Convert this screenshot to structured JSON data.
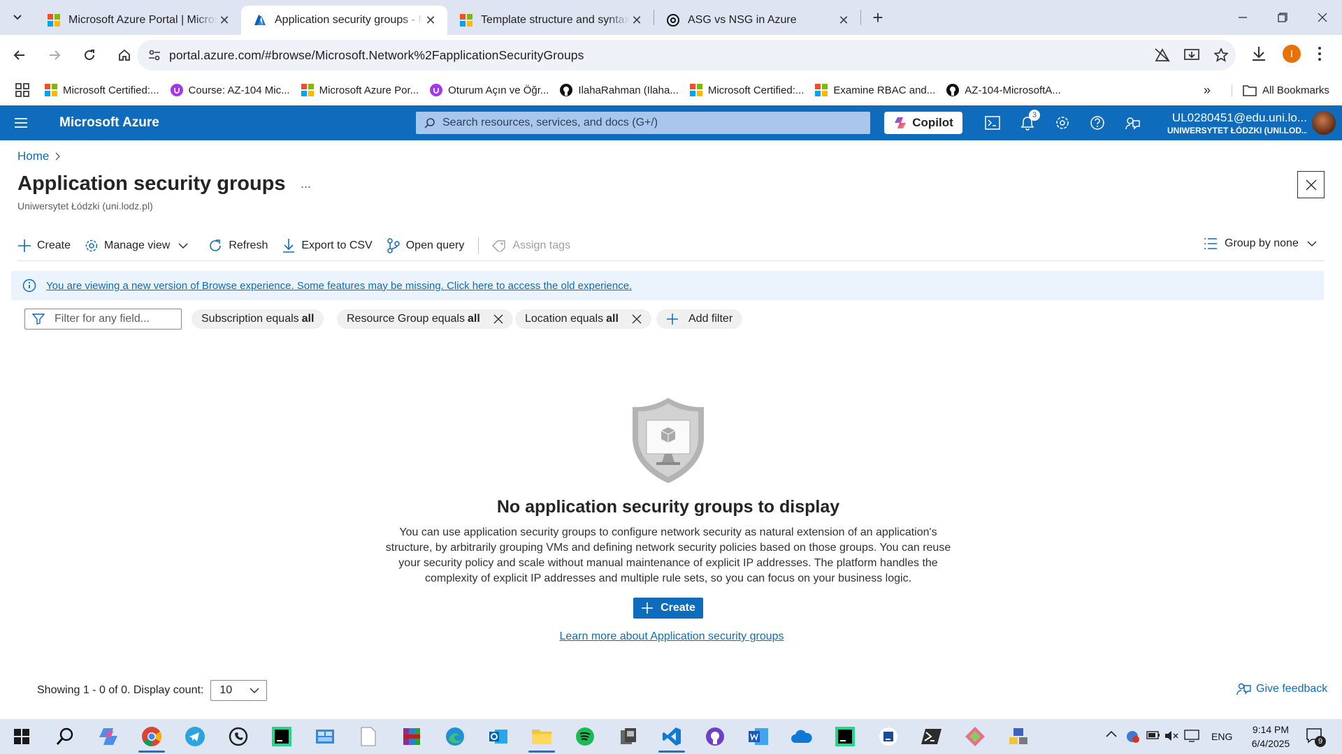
{
  "browser": {
    "tabs": [
      {
        "title": "Microsoft Azure Portal | Microsoft",
        "icon": "microsoft-logo-icon",
        "active": false
      },
      {
        "title": "Application security groups - Microsoft",
        "icon": "azure-logo-icon",
        "active": true
      },
      {
        "title": "Template structure and syntax - Azure",
        "icon": "microsoft-logo-icon",
        "active": false
      },
      {
        "title": "ASG vs NSG in Azure",
        "icon": "chatgpt-icon",
        "active": false
      }
    ],
    "url": "portal.azure.com/#browse/Microsoft.Network%2FapplicationSecurityGroups",
    "profile_initial": "I",
    "bookmarks": [
      {
        "label": "Microsoft Certified:...",
        "icon": "microsoft-logo-icon"
      },
      {
        "label": "Course: AZ-104 Mic...",
        "icon": "udemy-icon"
      },
      {
        "label": "Microsoft Azure Por...",
        "icon": "microsoft-logo-icon"
      },
      {
        "label": "Oturum Açın ve Öğr...",
        "icon": "udemy-icon"
      },
      {
        "label": "IlahaRahman (Ilaha...",
        "icon": "github-icon"
      },
      {
        "label": "Microsoft Certified:...",
        "icon": "microsoft-logo-icon"
      },
      {
        "label": "Examine RBAC and...",
        "icon": "microsoft-logo-icon"
      },
      {
        "label": "AZ-104-MicrosoftA...",
        "icon": "github-icon"
      }
    ],
    "all_bookmarks": "All Bookmarks"
  },
  "portal": {
    "brand": "Microsoft Azure",
    "search_placeholder": "Search resources, services, and docs (G+/)",
    "copilot": "Copilot",
    "notification_count": "3",
    "account_email": "UL0280451@edu.uni.lo...",
    "account_org": "UNIWERSYTET ŁÓDZKI (UNI.LOD..."
  },
  "page": {
    "breadcrumb_home": "Home",
    "title": "Application security groups",
    "more": "...",
    "subtitle": "Uniwersytet Łódzki (uni.lodz.pl)",
    "toolbar": {
      "create": "Create",
      "manage_view": "Manage view",
      "refresh": "Refresh",
      "export": "Export to CSV",
      "open_query": "Open query",
      "assign_tags": "Assign tags",
      "group_by": "Group by none"
    },
    "banner": "You are viewing a new version of Browse experience. Some features may be missing. Click here to access the old experience.",
    "filter_placeholder": "Filter for any field...",
    "filters": [
      {
        "label": "Subscription equals ",
        "value": "all",
        "removable": false
      },
      {
        "label": "Resource Group equals ",
        "value": "all",
        "removable": true
      },
      {
        "label": "Location equals ",
        "value": "all",
        "removable": true
      }
    ],
    "add_filter": "Add filter",
    "empty_title": "No application security groups to display",
    "empty_lines": [
      "You can use application security groups to configure network security as natural extension of an application's",
      "structure, by arbitrarily grouping VMs and defining network security policies based on those groups. You can reuse",
      "your security policy and scale without manual maintenance of explicit IP addresses. The platform handles the",
      "complexity of explicit IP addresses and multiple rule sets, so you can focus on your business logic."
    ],
    "create_button": "Create",
    "learn_more": "Learn more about Application security groups",
    "showing": "Showing 1 - 0 of 0. Display count:",
    "display_count": "10",
    "feedback": "Give feedback"
  },
  "taskbar": {
    "apps": [
      "start-icon",
      "search-icon",
      "copilot-icon",
      "chrome-icon",
      "telegram-icon",
      "whatsapp-icon",
      "clion-icon",
      "control-panel-icon",
      "file-icon",
      "winrar-icon",
      "edge-icon",
      "outlook-icon",
      "file-explorer-icon",
      "spotify-icon",
      "task-manager-icon",
      "vscode-icon",
      "github-desktop-icon",
      "word-icon",
      "onedrive-icon",
      "pycharm-icon",
      "intellij-icon",
      "powershell-icon",
      "git-icon",
      "network-icon"
    ],
    "language": "ENG",
    "time": "9:14 PM",
    "date": "6/4/2025",
    "notifications": "9"
  }
}
